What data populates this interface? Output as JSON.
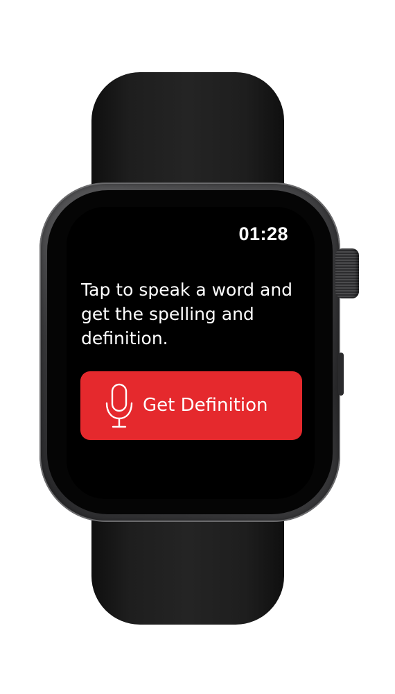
{
  "status_bar": {
    "time": "01:28"
  },
  "main": {
    "prompt_text": "Tap to speak a word and get the spelling and definition.",
    "action_button": {
      "label": "Get Definition",
      "icon": "microphone-icon",
      "color": "#e5292d"
    }
  },
  "device": {
    "type": "smartwatch",
    "case_color": "#38383a",
    "band_color": "#1e1e1e"
  }
}
